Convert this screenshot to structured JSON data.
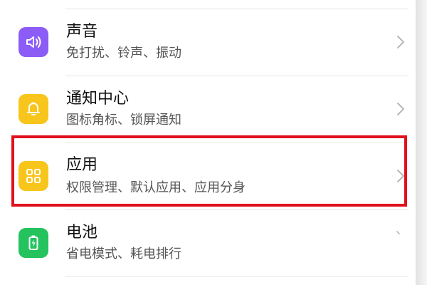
{
  "settings": {
    "items": [
      {
        "title": "声音",
        "subtitle": "免打扰、铃声、振动",
        "icon": "speaker-icon",
        "color": "#8b5cf6"
      },
      {
        "title": "通知中心",
        "subtitle": "图标角标、锁屏通知",
        "icon": "bell-icon",
        "color": "#f8c51c"
      },
      {
        "title": "应用",
        "subtitle": "权限管理、默认应用、应用分身",
        "icon": "grid-apps-icon",
        "color": "#f8c51c",
        "highlighted": true
      },
      {
        "title": "电池",
        "subtitle": "省电模式、耗电排行",
        "icon": "battery-icon",
        "color": "#24c35e"
      }
    ]
  },
  "colors": {
    "highlight": "#e0101d",
    "chevron": "#b8b8b8"
  }
}
